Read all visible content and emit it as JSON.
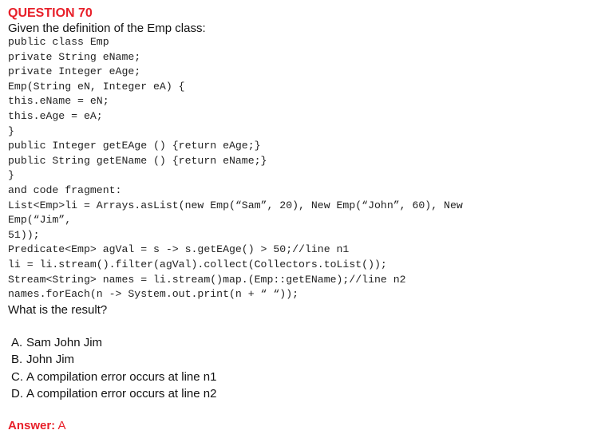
{
  "question": {
    "title": "QUESTION 70",
    "intro": "Given the definition of the Emp class:",
    "code_lines": [
      "public class Emp",
      "private String eName;",
      "private Integer eAge;",
      "Emp(String eN, Integer eA) {",
      "this.eName = eN;",
      "this.eAge = eA;",
      "}",
      "public Integer getEAge () {return eAge;}",
      "public String getEName () {return eName;}",
      "}",
      "and code fragment:",
      "List<Emp>li = Arrays.asList(new Emp(“Sam”, 20), New Emp(“John”, 60), New",
      "Emp(“Jim”,",
      "51));",
      "Predicate<Emp> agVal = s -> s.getEAge() > 50;//line n1",
      "li = li.stream().filter(agVal).collect(Collectors.toList());",
      "Stream<String> names = li.stream()map.(Emp::getEName);//line n2",
      "names.forEach(n -> System.out.print(n + “ “));"
    ],
    "prompt": "What is the result?",
    "options": [
      {
        "letter": "A.",
        "text": "Sam John Jim"
      },
      {
        "letter": "B.",
        "text": "John Jim"
      },
      {
        "letter": "C.",
        "text": "A compilation error occurs at line n1"
      },
      {
        "letter": "D.",
        "text": "A compilation error occurs at line n2"
      }
    ],
    "answer_label": "Answer:",
    "answer_value": "A"
  },
  "colors": {
    "accent": "#e8202a",
    "text": "#111111",
    "background": "#ffffff"
  }
}
